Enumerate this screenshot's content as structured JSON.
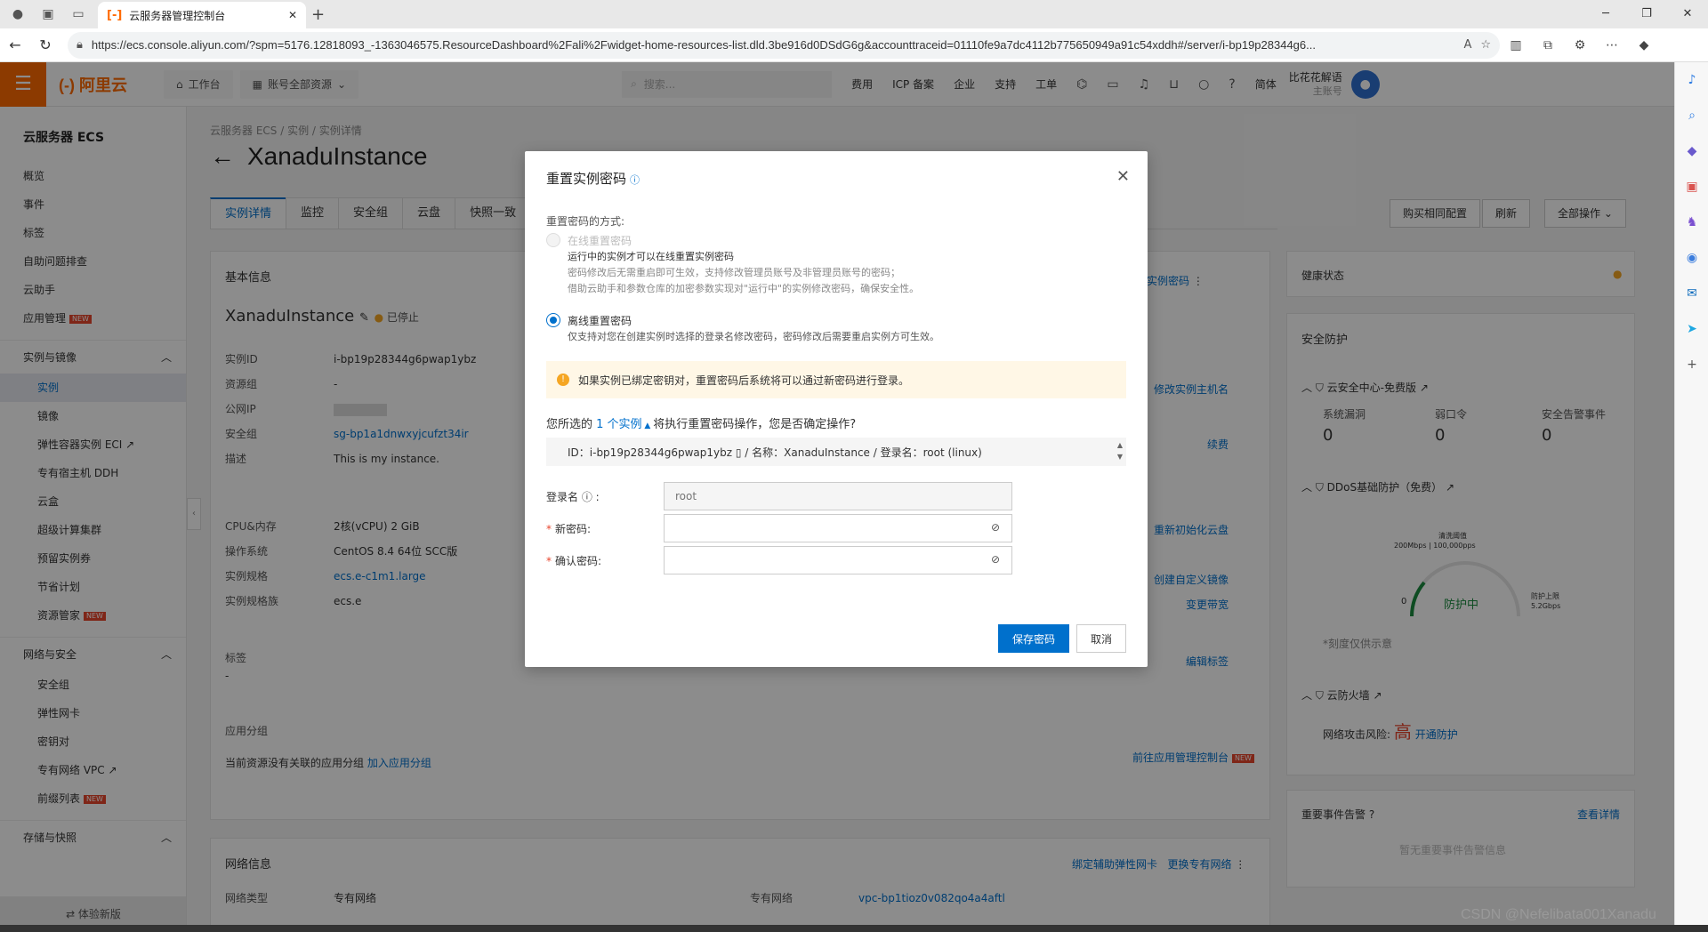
{
  "browser": {
    "tab_title": "云服务器管理控制台",
    "tab_favicon": "[-]",
    "url": "https://ecs.console.aliyun.com/?spm=5176.12818093_-1363046575.ResourceDashboard%2Fali%2Fwidget-home-resources-list.dld.3be916d0DSdG6g&accounttraceid=01110fe9a7dc4112b775650949a91c54xddh#/server/i-bp19p28344g6..."
  },
  "topnav": {
    "logo": "(-) 阿里云",
    "workbench": "工作台",
    "resource": "账号全部资源",
    "search_placeholder": "搜索...",
    "links": [
      "费用",
      "ICP 备案",
      "企业",
      "支持",
      "工单"
    ],
    "lang": "简体",
    "user_name": "比花花解语",
    "user_sub": "主账号"
  },
  "sidebar": {
    "brand": "云服务器 ECS",
    "top_items": [
      "概览",
      "事件",
      "标签",
      "自助问题排查",
      "云助手"
    ],
    "app_mgmt": "应用管理",
    "group1": "实例与镜像",
    "group1_items": [
      "实例",
      "镜像",
      "弹性容器实例 ECI",
      "专有宿主机 DDH",
      "云盒",
      "超级计算集群",
      "预留实例券",
      "节省计划",
      "资源管家"
    ],
    "group2": "网络与安全",
    "group2_items": [
      "安全组",
      "弹性网卡",
      "密钥对",
      "专有网络 VPC",
      "前缀列表"
    ],
    "group3": "存储与快照",
    "footer": "⇄ 体验新版",
    "new_badge": "NEW"
  },
  "content": {
    "breadcrumb": "云服务器 ECS  /  实例  /  实例详情",
    "title": "XanaduInstance",
    "tabs": [
      "实例详情",
      "监控",
      "安全组",
      "云盘",
      "快照一致"
    ],
    "buttons": [
      "购买相同配置",
      "刷新",
      "全部操作"
    ],
    "basic_title": "基本信息",
    "instance_name": "XanaduInstance",
    "status": "已停止",
    "kv": [
      {
        "k": "实例ID",
        "v": "i-bp19p28344g6pwap1ybz"
      },
      {
        "k": "资源组",
        "v": "-"
      },
      {
        "k": "公网IP",
        "v": ""
      },
      {
        "k": "安全组",
        "v": "sg-bp1a1dnwxyjcufzt34ir"
      },
      {
        "k": "描述",
        "v": "This is my instance."
      }
    ],
    "kv2": [
      {
        "k": "CPU&内存",
        "v": "2核(vCPU) 2 GiB"
      },
      {
        "k": "操作系统",
        "v": "CentOS 8.4 64位 SCC版"
      },
      {
        "k": "实例规格",
        "v": "ecs.e-c1m1.large"
      },
      {
        "k": "实例规格族",
        "v": "ecs.e"
      }
    ],
    "tags_label": "标签",
    "tags_value": "-",
    "app_group": "应用分组",
    "app_group_empty": "当前资源没有关联的应用分组",
    "add_app_group": "加入应用分组",
    "goto_app": "前往应用管理控制台",
    "right_links": [
      "重置实例密码",
      "修改实例主机名",
      "续费",
      "重新初始化云盘",
      "创建自定义镜像",
      "变更带宽",
      "编辑标签"
    ],
    "network_title": "网络信息",
    "network_links": [
      "绑定辅助弹性网卡",
      "更换专有网络"
    ],
    "net_type_k": "网络类型",
    "net_type_v": "专有网络",
    "vpc_k": "专有网络",
    "vpc_v": "vpc-bp1tioz0v082qo4a4aftl",
    "health": "健康状态",
    "security": "安全防护",
    "sec_center": "云安全中心-免费版",
    "sec_stats": [
      {
        "k": "系统漏洞",
        "v": "0"
      },
      {
        "k": "弱口令",
        "v": "0"
      },
      {
        "k": "安全告警事件",
        "v": "0"
      }
    ],
    "ddos": "DDoS基础防护（免费）",
    "ddos_threshold": "清洗阈值",
    "ddos_threshold_v": "200Mbps | 100,000pps",
    "ddos_state": "防护中",
    "ddos_zero": "0",
    "ddos_max": "防护上限",
    "ddos_max_v": "5.2Gbps",
    "ddos_note": "*刻度仅供示意",
    "firewall": "云防火墙",
    "attack_risk": "网络攻击风险:",
    "risk_level": "高",
    "open_protect": "开通防护",
    "events": "重要事件告警",
    "events_link": "查看详情",
    "events_empty": "暂无重要事件告警信息"
  },
  "dialog": {
    "title": "重置实例密码",
    "method_label": "重置密码的方式:",
    "online_title": "在线重置密码",
    "online_desc1": "运行中的实例才可以在线重置实例密码",
    "online_desc2": "密码修改后无需重启即可生效，支持修改管理员账号及非管理员账号的密码；",
    "online_desc3": "借助云助手和参数仓库的加密参数实现对\"运行中\"的实例修改密码，确保安全性。",
    "offline_title": "离线重置密码",
    "offline_desc": "仅支持对您在创建实例时选择的登录名修改密码，密码修改后需要重启实例方可生效。",
    "warning": "如果实例已绑定密钥对，重置密码后系统将可以通过新密码进行登录。",
    "selected_prefix": "您所选的",
    "selected_count": "1 个实例",
    "selected_suffix": "将执行重置密码操作，您是否确定操作?",
    "instance_line": "ID：i-bp19p28344g6pwap1ybz ▯ / 名称：XanaduInstance / 登录名：root (linux)",
    "login_label": "登录名",
    "login_placeholder": "root",
    "new_pwd_label": "新密码:",
    "confirm_pwd_label": "确认密码:",
    "save": "保存密码",
    "cancel": "取消"
  },
  "watermark": "CSDN @Nefelibata001Xanadu",
  "colors": {
    "brand": "#ff6a00",
    "primary": "#0070cc",
    "warn_bg": "#fff7e6",
    "danger": "#e8452c"
  }
}
